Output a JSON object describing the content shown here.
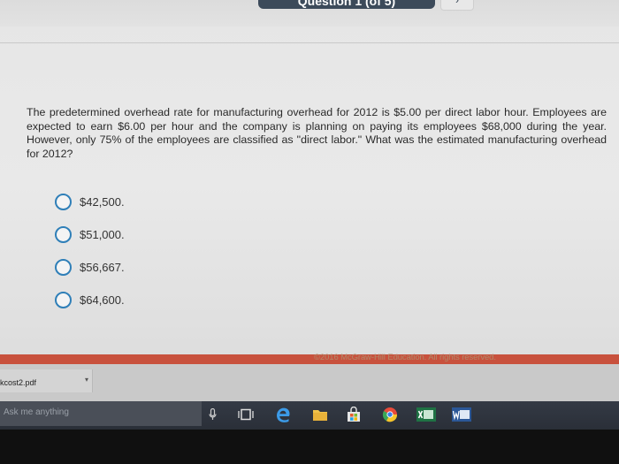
{
  "nav": {
    "question_label": "Question 1 (of 5)",
    "next_glyph": "›"
  },
  "question": {
    "text": "The predetermined overhead rate for manufacturing overhead for 2012 is $5.00 per direct labor hour. Employees are expected to earn $6.00 per hour and the company is planning on paying its employees $68,000 during the year. However, only 75% of the employees are classified as \"direct labor.\" What was the estimated manufacturing overhead for 2012?"
  },
  "options": [
    {
      "label": "$42,500."
    },
    {
      "label": "$51,000."
    },
    {
      "label": "$56,667."
    },
    {
      "label": "$64,600."
    }
  ],
  "footer": {
    "copyright": "©2016 McGraw-Hill Education. All rights reserved."
  },
  "downloads": {
    "file_name": "kcost2.pdf",
    "chevron": "▾"
  },
  "taskbar": {
    "search_placeholder": "Ask me anything"
  },
  "colors": {
    "accent": "#2f7fb8",
    "footer_bar": "#c8513d",
    "taskbar": "#2f343d"
  }
}
